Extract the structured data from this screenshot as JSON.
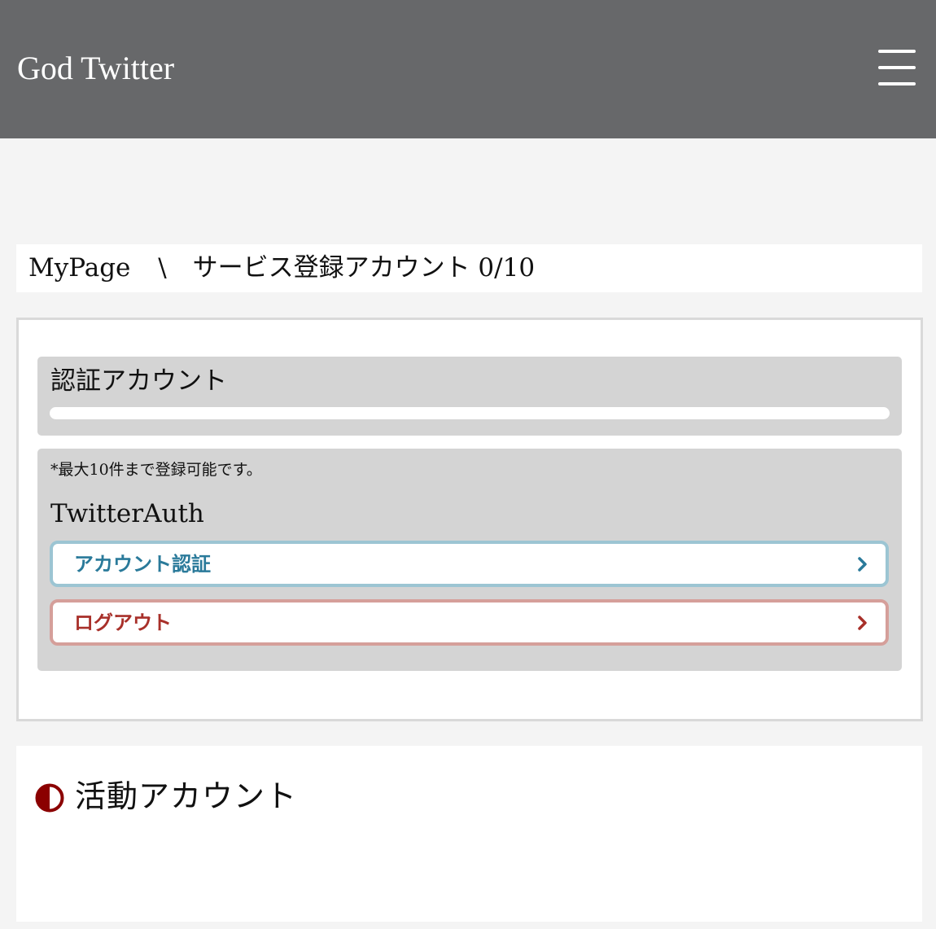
{
  "header": {
    "title": "God Twitter",
    "menu_icon": "hamburger-icon",
    "background": "#67686a"
  },
  "breadcrumb": {
    "root": "MyPage",
    "separator": "\\",
    "current": "サービス登録アカウント 0/10"
  },
  "auth_panel": {
    "title": "認証アカウント",
    "note": "*最大10件まで登録可能です。",
    "provider": "TwitterAuth",
    "buttons": [
      {
        "label": "アカウント認証",
        "icon": "chevron-right-icon",
        "color": "#2a7a9a"
      },
      {
        "label": "ログアウト",
        "icon": "chevron-right-icon",
        "color": "#a8302a"
      }
    ]
  },
  "active_section": {
    "icon": "half-circle-icon",
    "icon_color": "#8b0000",
    "title": "活動アカウント"
  }
}
